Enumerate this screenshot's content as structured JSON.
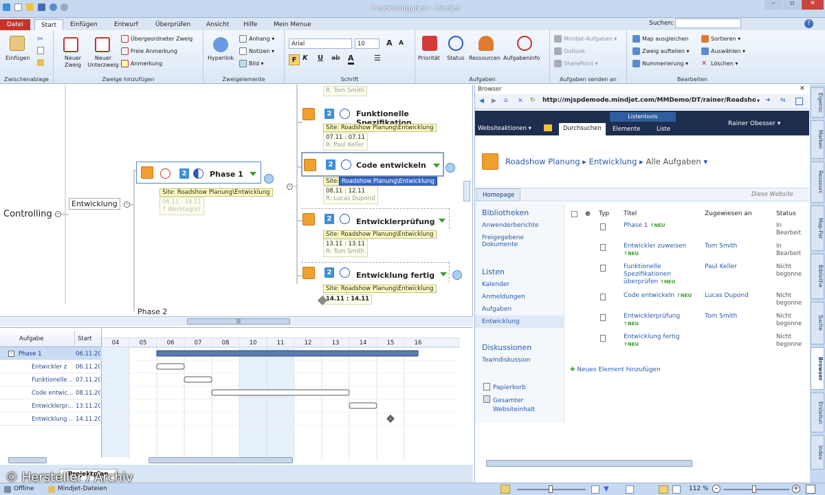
{
  "title": {
    "app_title": "Projektaufgaben - Mindjet",
    "search_label": "Suchen:"
  },
  "tabs": [
    "Datei",
    "Start",
    "Einfügen",
    "Entwurf",
    "Überprüfen",
    "Ansicht",
    "Hilfe",
    "Mein Menue"
  ],
  "ribbon": {
    "clip": {
      "paste": "Einfügen",
      "label": "Zwischenablage"
    },
    "add": {
      "new_branch": "Neuer Zweig",
      "new_sub": "Neuer Unterzweig",
      "parent": "Übergeordneter Zweig",
      "free_note": "Freie Anmerkung",
      "note": "Anmerkung",
      "label": "Zweige hinzufügen"
    },
    "elements": {
      "hyperlink": "Hyperlink",
      "attach": "Anhang",
      "notes": "Notizen",
      "image": "Bild",
      "label": "Zweigelemente"
    },
    "font": {
      "family": "Arial",
      "size": "10",
      "label": "Schrift"
    },
    "tasks": {
      "priority": "Priorität",
      "status": "Status",
      "resources": "Ressourcen",
      "taskinfo": "Aufgabeninfo",
      "label": "Aufgaben"
    },
    "send": {
      "mindjet": "Mindjet-Aufgaben",
      "outlook": "Outlook",
      "sharepoint": "SharePoint",
      "label": "Aufgaben senden an"
    },
    "edit": {
      "balance": "Map ausgleichen",
      "split": "Zweig aufteilen",
      "numbering": "Nummerierung",
      "sort": "Sortieren",
      "select": "Auswählen",
      "delete": "Löschen",
      "label": "Bearbeiten"
    }
  },
  "map": {
    "controlling": "Controlling",
    "entwicklung": "Entwicklung",
    "phase1": {
      "title": "Phase 1",
      "site": "Site: Roadshow Planung\\Entwicklung",
      "dates": "06.11 : 14.11",
      "days": "7 Werktag(e)"
    },
    "phase2": "Phase 2",
    "top_resource": "R: Tom Smith",
    "tasks": [
      {
        "title": "Funktionelle Spezifikation",
        "site": "Site: Roadshow Planung\\Entwicklung",
        "dates": "07.11 : 07.11",
        "resource": "R: Paul Keller"
      },
      {
        "title": "Code entwickeln",
        "site": "Roadshow Planung\\Entwicklung",
        "site_prefix": "Site:",
        "dates": "08.11 : 12.11",
        "resource": "R: Lucas Dupond"
      },
      {
        "title": "Entwicklerprüfung",
        "site": "Site: Roadshow Planung\\Entwicklung",
        "dates": "13.11 : 13.11",
        "resource": "R: Tom Smith"
      },
      {
        "title": "Entwicklung fertig",
        "site": "Site: Roadshow Planung\\Entwicklung",
        "dates": "14.11 : 14.11"
      }
    ]
  },
  "gantt": {
    "col_task": "Aufgabe",
    "col_start": "Start",
    "days": [
      "04",
      "05",
      "06",
      "07",
      "08",
      "10",
      "11",
      "12",
      "13",
      "14",
      "15",
      "16"
    ],
    "rows": [
      {
        "task": "Phase 1",
        "start": "06.11.20",
        "s": 2,
        "e": 11.5,
        "type": "summary"
      },
      {
        "task": "Entwickler z",
        "start": "06.11.20",
        "s": 2,
        "e": 3,
        "type": "task"
      },
      {
        "task": "Funktionelle ...",
        "start": "07.11.20",
        "s": 3,
        "e": 4,
        "type": "task"
      },
      {
        "task": "Code entwic...",
        "start": "08.11.20",
        "s": 4,
        "e": 9,
        "type": "task"
      },
      {
        "task": "Entwicklerpr...",
        "start": "13.11.20",
        "s": 9,
        "e": 10,
        "type": "task"
      },
      {
        "task": "Entwicklung ...",
        "start": "14.11.20",
        "s": 10.5,
        "e": 10.5,
        "type": "milestone"
      }
    ]
  },
  "bottom": {
    "tab": "Projektplan",
    "offline": "Offline",
    "files": "Mindjet-Dateien",
    "zoom": "112 %"
  },
  "browser": {
    "title": "Browser",
    "url": "http://mjspdemode.mindjet.com/MMDemo/DT/rainer/Roadshow%",
    "site_actions": "Websiteaktionen",
    "browse": "Durchsuchen",
    "listtools": "Listentools",
    "elements": "Elemente",
    "list": "Liste",
    "user": "Rainer Obesser",
    "breadcrumb": [
      "Roadshow Planung",
      "Entwicklung",
      "Alle Aufgaben"
    ],
    "homepage": "Homepage",
    "search_site": "Diese Website",
    "left": {
      "libraries": "Bibliotheken",
      "user_reports": "Anwenderberichte",
      "shared_docs": "Freigegebene Dokumente",
      "lists": "Listen",
      "calendar": "Kalender",
      "registrations": "Anmeldungen",
      "tasks": "Aufgaben",
      "dev": "Entwicklung",
      "discussions": "Diskussionen",
      "team_disc": "Teamdiskussion",
      "recycle": "Papierkorb",
      "all_content": "Gesamter Websiteinhalt"
    },
    "cols": {
      "type": "Typ",
      "title": "Titel",
      "assigned": "Zugewiesen an",
      "status": "Status"
    },
    "rows": [
      {
        "title": "Phase 1",
        "assigned": "",
        "status": "In Bearbeit"
      },
      {
        "title": "Entwickler zuweisen",
        "assigned": "Tom Smith",
        "status": "In Bearbeit"
      },
      {
        "title": "Funktionelle Spezifikationen überprüfen",
        "assigned": "Paul Keller",
        "status": "Nicht begonne"
      },
      {
        "title": "Code entwickeln",
        "assigned": "Lucas Dupond",
        "status": "Nicht begonne"
      },
      {
        "title": "Entwicklerprüfung",
        "assigned": "Tom Smith",
        "status": "Nicht begonne"
      },
      {
        "title": "Entwicklung fertig",
        "assigned": "",
        "status": "Nicht begonne"
      }
    ],
    "neu": "NEU",
    "add_item": "Neues Element hinzufügen"
  },
  "sidetabs": [
    "Eigensc",
    "Marken",
    "Ressourc",
    "Map-Par",
    "Bibliothe",
    "Suche",
    "Browser",
    "Erstellun",
    "Index"
  ],
  "watermark": "© Hersteller / Archiv"
}
